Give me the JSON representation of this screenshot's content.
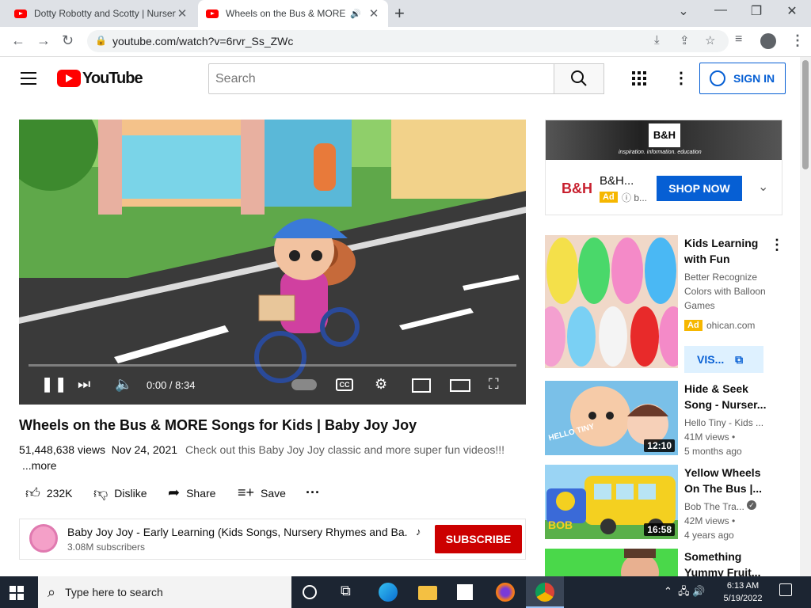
{
  "browser": {
    "tabs": [
      {
        "title": "Dotty Robotty and Scotty | Nursery Rhymes",
        "active": false
      },
      {
        "title": "Wheels on the Bus & MORE Songs for Kids",
        "active": true,
        "audio_icon": "speaker-icon"
      }
    ],
    "url": "youtube.com/watch?v=6rvr_Ss_ZWc"
  },
  "youtube": {
    "logo_text": "YouTube",
    "search_placeholder": "Search",
    "sign_in": "SIGN IN"
  },
  "player": {
    "time": "0:00 / 8:34",
    "progress": 0
  },
  "video": {
    "title": "Wheels on the Bus & MORE Songs for Kids | Baby Joy Joy",
    "views": "51,448,638 views",
    "date": "Nov 24, 2021",
    "description_snippet": "Check out this Baby Joy Joy classic and more super fun videos!!!",
    "more": "...more",
    "likes": "232K",
    "dislike": "Dislike",
    "share": "Share",
    "save": "Save"
  },
  "channel": {
    "name": "Baby Joy Joy - Early Learning (Kids Songs, Nursery Rhymes and Ba...",
    "subscribers": "3.08M subscribers",
    "subscribe": "SUBSCRIBE"
  },
  "sidebar_ad": {
    "banner_logo": "B&H",
    "banner_tagline": "inspiration. information. education",
    "brand_logo": "B&H",
    "name": "B&H...",
    "badge": "Ad",
    "info": "b...",
    "cta": "SHOP NOW"
  },
  "recommendations": [
    {
      "title": "Kids Learning with Fun",
      "description": "Better Recognize Colors with Balloon Games",
      "badge": "Ad",
      "domain": "ohican.com",
      "cta": "VIS..."
    },
    {
      "title": "Hide & Seek Song - Nurser...",
      "channel": "Hello Tiny - Kids ...",
      "views": "41M views •",
      "age": "5 months ago",
      "duration": "12:10",
      "thumb_text": "HELLO TINY"
    },
    {
      "title": "Yellow Wheels On The Bus |...",
      "channel": "Bob The Tra...",
      "verified": true,
      "views": "42M views •",
      "age": "4 years ago",
      "duration": "16:58",
      "thumb_text": "BOB"
    },
    {
      "title": "Something Yummy Fruit..."
    }
  ],
  "taskbar": {
    "search_placeholder": "Type here to search",
    "time": "6:13 AM",
    "date": "5/19/2022"
  },
  "colors": {
    "youtube_red": "#ff0000",
    "subscribe_red": "#cc0000",
    "link_blue": "#065fd4",
    "ad_yellow": "#f6b700",
    "taskbar": "#1c2532"
  }
}
